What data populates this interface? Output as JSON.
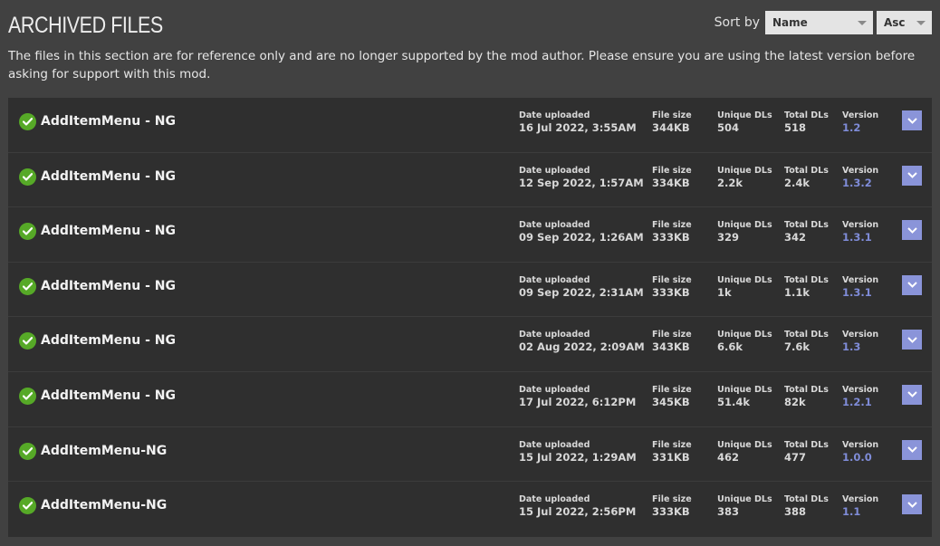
{
  "header": {
    "title": "ARCHIVED FILES"
  },
  "sort": {
    "label": "Sort by",
    "field": "Name",
    "direction": "Asc"
  },
  "notice": "The files in this section are for reference only and are no longer supported by the mod author. Please ensure you are using the latest version before asking for support with this mod.",
  "columns": {
    "date": "Date uploaded",
    "size": "File size",
    "unique": "Unique DLs",
    "total": "Total DLs",
    "version": "Version"
  },
  "colors": {
    "check": "#56a927",
    "version": "#7f8cd8",
    "expand": "#8a94d9"
  },
  "icons": {
    "status": "check-circle-icon",
    "expand": "chevron-down-icon",
    "sort": "caret-down-icon"
  },
  "files": [
    {
      "name": "AddItemMenu - NG",
      "date": "16 Jul 2022, 3:55AM",
      "size": "344KB",
      "unique": "504",
      "total": "518",
      "version": "1.2"
    },
    {
      "name": "AddItemMenu - NG",
      "date": "12 Sep 2022, 1:57AM",
      "size": "334KB",
      "unique": "2.2k",
      "total": "2.4k",
      "version": "1.3.2"
    },
    {
      "name": "AddItemMenu - NG",
      "date": "09 Sep 2022, 1:26AM",
      "size": "333KB",
      "unique": "329",
      "total": "342",
      "version": "1.3.1"
    },
    {
      "name": "AddItemMenu - NG",
      "date": "09 Sep 2022, 2:31AM",
      "size": "333KB",
      "unique": "1k",
      "total": "1.1k",
      "version": "1.3.1"
    },
    {
      "name": "AddItemMenu - NG",
      "date": "02 Aug 2022, 2:09AM",
      "size": "343KB",
      "unique": "6.6k",
      "total": "7.6k",
      "version": "1.3"
    },
    {
      "name": "AddItemMenu - NG",
      "date": "17 Jul 2022, 6:12PM",
      "size": "345KB",
      "unique": "51.4k",
      "total": "82k",
      "version": "1.2.1"
    },
    {
      "name": "AddItemMenu-NG",
      "date": "15 Jul 2022, 1:29AM",
      "size": "331KB",
      "unique": "462",
      "total": "477",
      "version": "1.0.0"
    },
    {
      "name": "AddItemMenu-NG",
      "date": "15 Jul 2022, 2:56PM",
      "size": "333KB",
      "unique": "383",
      "total": "388",
      "version": "1.1"
    }
  ]
}
